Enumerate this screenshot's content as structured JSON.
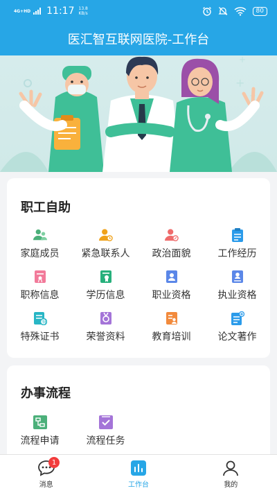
{
  "status_bar": {
    "network": "4G+HD",
    "time": "11:17",
    "net_speed_value": "13.8",
    "net_speed_unit": "KB/s",
    "battery": "80",
    "icons": [
      "alarm-icon",
      "mute-icon",
      "wifi-icon",
      "battery-icon"
    ]
  },
  "header": {
    "title": "医汇智互联网医院-工作台"
  },
  "banner": {
    "image": "three-medical-staff-illustration"
  },
  "self_service": {
    "title": "职工自助",
    "items": [
      {
        "label": "家庭成员",
        "icon": "family-members-icon",
        "color": "#4cb07a"
      },
      {
        "label": "紧急联系人",
        "icon": "emergency-contact-icon",
        "color": "#f0a21b"
      },
      {
        "label": "政治面貌",
        "icon": "political-status-icon",
        "color": "#ef6b6b"
      },
      {
        "label": "工作经历",
        "icon": "work-history-icon",
        "color": "#2b9bea"
      },
      {
        "label": "职称信息",
        "icon": "title-info-icon",
        "color": "#f27a9a"
      },
      {
        "label": "学历信息",
        "icon": "education-info-icon",
        "color": "#27b07c"
      },
      {
        "label": "职业资格",
        "icon": "occupational-qualification-icon",
        "color": "#5b87e8"
      },
      {
        "label": "执业资格",
        "icon": "practice-qualification-icon",
        "color": "#5b87e8"
      },
      {
        "label": "特殊证书",
        "icon": "special-certificate-icon",
        "color": "#28b6c5"
      },
      {
        "label": "荣誉资料",
        "icon": "honor-icon",
        "color": "#a474d8"
      },
      {
        "label": "教育培训",
        "icon": "training-icon",
        "color": "#f28a3c"
      },
      {
        "label": "论文著作",
        "icon": "paper-icon",
        "color": "#2b9bea"
      }
    ]
  },
  "workflow": {
    "title": "办事流程",
    "items": [
      {
        "label": "流程申请",
        "icon": "process-apply-icon",
        "color": "#4cb07a"
      },
      {
        "label": "流程任务",
        "icon": "process-task-icon",
        "color": "#a474d8"
      }
    ]
  },
  "tab_bar": {
    "tabs": [
      {
        "label": "消息",
        "icon": "message-icon",
        "badge": "1"
      },
      {
        "label": "工作台",
        "icon": "workbench-icon"
      },
      {
        "label": "我的",
        "icon": "profile-icon"
      }
    ],
    "active_color": "#27a6e6"
  },
  "colors": {
    "primary": "#27a6e6"
  }
}
